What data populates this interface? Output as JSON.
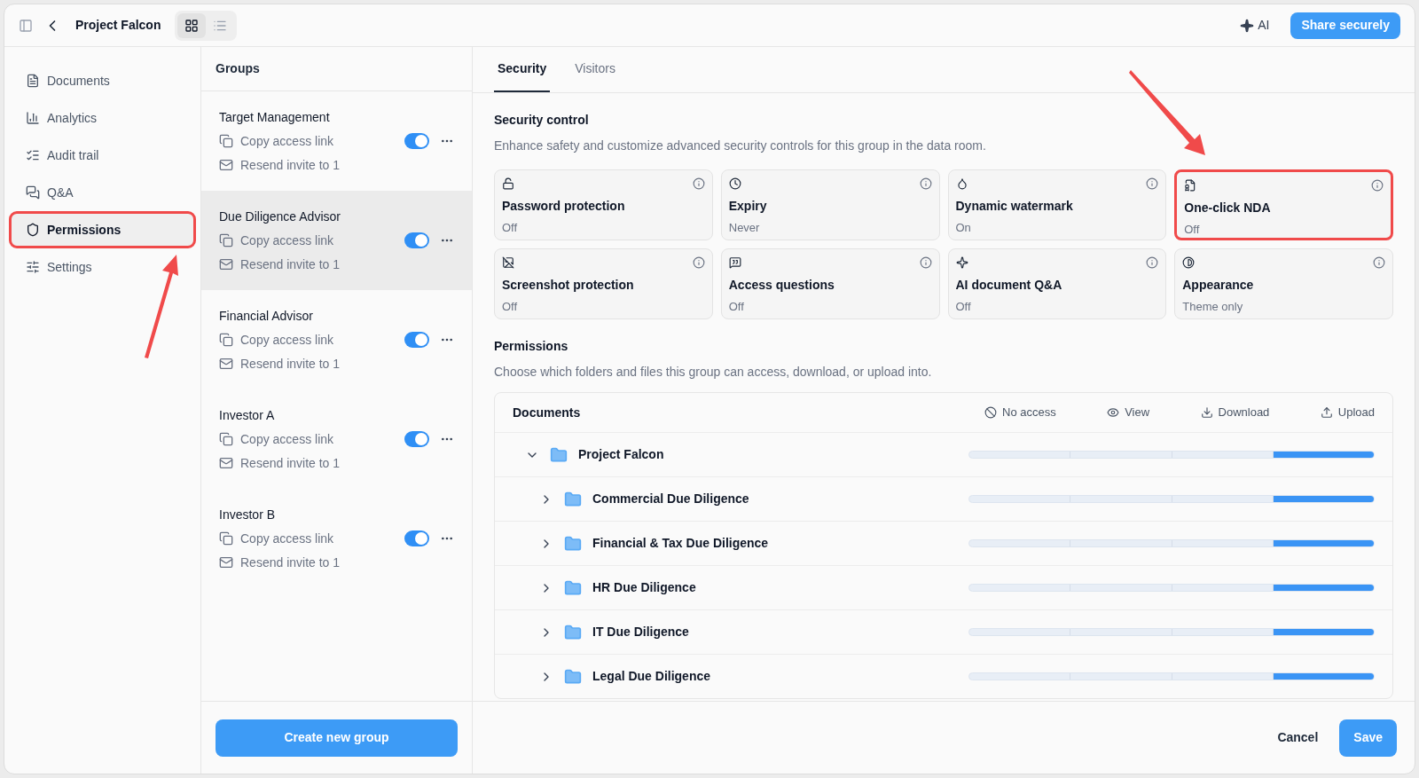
{
  "header": {
    "title": "Project Falcon",
    "views": [
      {
        "kind": "grid",
        "selected": true
      },
      {
        "kind": "list",
        "selected": false
      }
    ],
    "ai": "AI",
    "share": "Share securely"
  },
  "nav": [
    {
      "kind": "documents",
      "label": "Documents",
      "selected": false,
      "highlighted": false
    },
    {
      "kind": "analytics",
      "label": "Analytics",
      "selected": false,
      "highlighted": false
    },
    {
      "kind": "audit",
      "label": "Audit trail",
      "selected": false,
      "highlighted": false
    },
    {
      "kind": "qa",
      "label": "Q&A",
      "selected": false,
      "highlighted": false
    },
    {
      "kind": "permissions",
      "label": "Permissions",
      "selected": true,
      "highlighted": true
    },
    {
      "kind": "settings",
      "label": "Settings",
      "selected": false,
      "highlighted": false
    }
  ],
  "groups": {
    "title": "Groups",
    "items": [
      {
        "name": "Target Management",
        "copy": "Copy access link",
        "resend": "Resend invite to 1",
        "on": true,
        "selected": false
      },
      {
        "name": "Due Diligence Advisor",
        "copy": "Copy access link",
        "resend": "Resend invite to 1",
        "on": true,
        "selected": true
      },
      {
        "name": "Financial Advisor",
        "copy": "Copy access link",
        "resend": "Resend invite to 1",
        "on": true,
        "selected": false
      },
      {
        "name": "Investor A",
        "copy": "Copy access link",
        "resend": "Resend invite to 1",
        "on": true,
        "selected": false
      },
      {
        "name": "Investor B",
        "copy": "Copy access link",
        "resend": "Resend invite to 1",
        "on": true,
        "selected": false
      }
    ],
    "create": "Create new group"
  },
  "tabs": [
    {
      "label": "Security",
      "selected": true
    },
    {
      "label": "Visitors",
      "selected": false
    }
  ],
  "security": {
    "title": "Security control",
    "subtitle": "Enhance safety and customize advanced security controls for this group in the data room.",
    "cards": [
      {
        "kind": "lock",
        "title": "Password protection",
        "value": "Off",
        "highlighted": false
      },
      {
        "kind": "clock",
        "title": "Expiry",
        "value": "Never",
        "highlighted": false
      },
      {
        "kind": "drop",
        "title": "Dynamic watermark",
        "value": "On",
        "highlighted": false
      },
      {
        "kind": "doc",
        "title": "One-click NDA",
        "value": "Off",
        "highlighted": true
      },
      {
        "kind": "screenshot",
        "title": "Screenshot protection",
        "value": "Off",
        "highlighted": false
      },
      {
        "kind": "questions",
        "title": "Access questions",
        "value": "Off",
        "highlighted": false
      },
      {
        "kind": "sparkle",
        "title": "AI document Q&A",
        "value": "Off",
        "highlighted": false
      },
      {
        "kind": "contrast",
        "title": "Appearance",
        "value": "Theme only",
        "highlighted": false
      }
    ]
  },
  "permissions": {
    "title": "Permissions",
    "subtitle": "Choose which folders and files this group can access, download, or upload into.",
    "table": {
      "title": "Documents",
      "columns": [
        {
          "kind": "none",
          "label": "No access"
        },
        {
          "kind": "view",
          "label": "View"
        },
        {
          "kind": "download",
          "label": "Download"
        },
        {
          "kind": "upload",
          "label": "Upload"
        }
      ],
      "rows": [
        {
          "name": "Project Falcon",
          "expanded": true,
          "children": [
            {
              "name": "Commercial Due Diligence",
              "expanded": false,
              "access": [
                {
                  "selected": false
                },
                {
                  "selected": false
                },
                {
                  "selected": false
                },
                {
                  "selected": true
                }
              ]
            },
            {
              "name": "Financial & Tax Due Diligence",
              "expanded": false,
              "access": [
                {
                  "selected": false
                },
                {
                  "selected": false
                },
                {
                  "selected": false
                },
                {
                  "selected": true
                }
              ]
            },
            {
              "name": "HR Due Diligence",
              "expanded": false,
              "access": [
                {
                  "selected": false
                },
                {
                  "selected": false
                },
                {
                  "selected": false
                },
                {
                  "selected": true
                }
              ]
            },
            {
              "name": "IT Due Diligence",
              "expanded": false,
              "access": [
                {
                  "selected": false
                },
                {
                  "selected": false
                },
                {
                  "selected": false
                },
                {
                  "selected": true
                }
              ]
            },
            {
              "name": "Legal Due Diligence",
              "expanded": false,
              "access": [
                {
                  "selected": false
                },
                {
                  "selected": false
                },
                {
                  "selected": false
                },
                {
                  "selected": true
                }
              ]
            }
          ],
          "access": [
            {
              "selected": false
            },
            {
              "selected": false
            },
            {
              "selected": false
            },
            {
              "selected": true
            }
          ]
        }
      ]
    }
  },
  "footer": {
    "cancel": "Cancel",
    "save": "Save"
  }
}
